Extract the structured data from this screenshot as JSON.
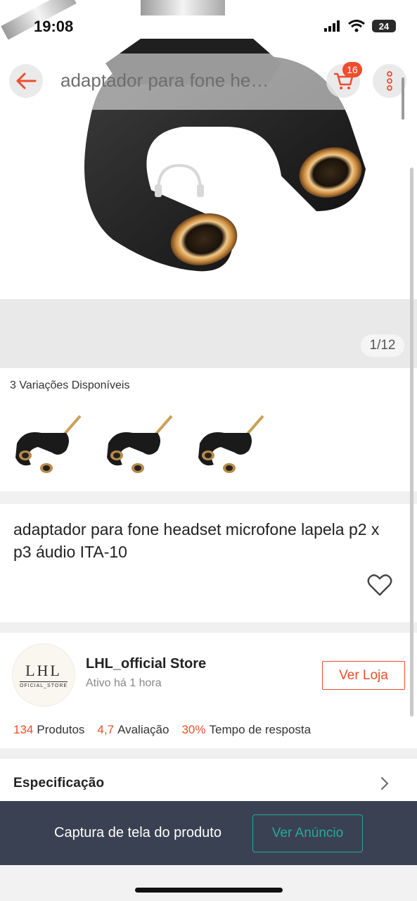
{
  "status": {
    "time": "19:08",
    "battery": "24"
  },
  "nav": {
    "search_text": "adaptador para fone he…",
    "cart_count": "16"
  },
  "gallery": {
    "counter": "1/12"
  },
  "variations": {
    "title": "3 Variações Disponíveis",
    "count": 3
  },
  "product": {
    "title": "adaptador para fone headset microfone lapela p2 x p3 áudio ITA-10"
  },
  "store": {
    "logo_text": "LHL",
    "logo_sub": "OFICIAL_STORE",
    "name": "LHL_official Store",
    "active": "Ativo há 1 hora",
    "button": "Ver Loja",
    "stats": [
      {
        "value": "134",
        "label": "Produtos"
      },
      {
        "value": "4,7",
        "label": "Avaliação"
      },
      {
        "value": "30%",
        "label": "Tempo de resposta"
      }
    ]
  },
  "spec": {
    "label": "Especificação"
  },
  "bottom": {
    "text": "Captura de tela do produto",
    "button": "Ver Anúncio"
  },
  "colors": {
    "accent": "#ee4d2d",
    "teal": "#26aa99",
    "bottom_bar": "#3a4152"
  }
}
